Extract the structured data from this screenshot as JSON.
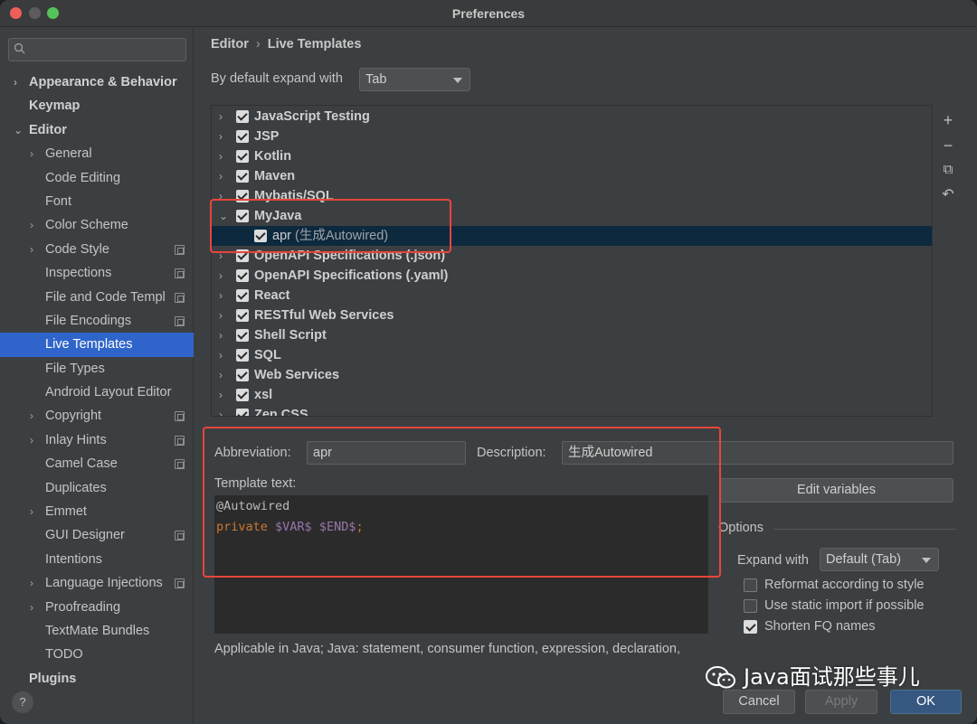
{
  "window": {
    "title": "Preferences"
  },
  "sidebar": {
    "search_placeholder": "",
    "items": [
      {
        "label": "Appearance & Behavior",
        "chev": "›",
        "bold": true,
        "indent": 0,
        "cfg": false,
        "selected": false
      },
      {
        "label": "Keymap",
        "chev": "",
        "bold": true,
        "indent": 0,
        "cfg": false,
        "selected": false
      },
      {
        "label": "Editor",
        "chev": "⌄",
        "bold": true,
        "indent": 0,
        "cfg": false,
        "selected": false
      },
      {
        "label": "General",
        "chev": "›",
        "bold": false,
        "indent": 1,
        "cfg": false,
        "selected": false
      },
      {
        "label": "Code Editing",
        "chev": "",
        "bold": false,
        "indent": 1,
        "cfg": false,
        "selected": false
      },
      {
        "label": "Font",
        "chev": "",
        "bold": false,
        "indent": 1,
        "cfg": false,
        "selected": false
      },
      {
        "label": "Color Scheme",
        "chev": "›",
        "bold": false,
        "indent": 1,
        "cfg": false,
        "selected": false
      },
      {
        "label": "Code Style",
        "chev": "›",
        "bold": false,
        "indent": 1,
        "cfg": true,
        "selected": false
      },
      {
        "label": "Inspections",
        "chev": "",
        "bold": false,
        "indent": 1,
        "cfg": true,
        "selected": false
      },
      {
        "label": "File and Code Templ",
        "chev": "",
        "bold": false,
        "indent": 1,
        "cfg": true,
        "selected": false
      },
      {
        "label": "File Encodings",
        "chev": "",
        "bold": false,
        "indent": 1,
        "cfg": true,
        "selected": false
      },
      {
        "label": "Live Templates",
        "chev": "",
        "bold": false,
        "indent": 1,
        "cfg": false,
        "selected": true
      },
      {
        "label": "File Types",
        "chev": "",
        "bold": false,
        "indent": 1,
        "cfg": false,
        "selected": false
      },
      {
        "label": "Android Layout Editor",
        "chev": "",
        "bold": false,
        "indent": 1,
        "cfg": false,
        "selected": false
      },
      {
        "label": "Copyright",
        "chev": "›",
        "bold": false,
        "indent": 1,
        "cfg": true,
        "selected": false
      },
      {
        "label": "Inlay Hints",
        "chev": "›",
        "bold": false,
        "indent": 1,
        "cfg": true,
        "selected": false
      },
      {
        "label": "Camel Case",
        "chev": "",
        "bold": false,
        "indent": 1,
        "cfg": true,
        "selected": false
      },
      {
        "label": "Duplicates",
        "chev": "",
        "bold": false,
        "indent": 1,
        "cfg": false,
        "selected": false
      },
      {
        "label": "Emmet",
        "chev": "›",
        "bold": false,
        "indent": 1,
        "cfg": false,
        "selected": false
      },
      {
        "label": "GUI Designer",
        "chev": "",
        "bold": false,
        "indent": 1,
        "cfg": true,
        "selected": false
      },
      {
        "label": "Intentions",
        "chev": "",
        "bold": false,
        "indent": 1,
        "cfg": false,
        "selected": false
      },
      {
        "label": "Language Injections",
        "chev": "›",
        "bold": false,
        "indent": 1,
        "cfg": true,
        "selected": false
      },
      {
        "label": "Proofreading",
        "chev": "›",
        "bold": false,
        "indent": 1,
        "cfg": false,
        "selected": false
      },
      {
        "label": "TextMate Bundles",
        "chev": "",
        "bold": false,
        "indent": 1,
        "cfg": false,
        "selected": false
      },
      {
        "label": "TODO",
        "chev": "",
        "bold": false,
        "indent": 1,
        "cfg": false,
        "selected": false
      },
      {
        "label": "Plugins",
        "chev": "",
        "bold": true,
        "indent": 0,
        "cfg": false,
        "selected": false
      }
    ],
    "help_label": "?"
  },
  "breadcrumb": {
    "parent": "Editor",
    "separator": "›",
    "current": "Live Templates"
  },
  "expand_default": {
    "label": "By default expand with",
    "value": "Tab"
  },
  "template_tree": [
    {
      "label": "JavaScript Testing",
      "desc": "",
      "chev": "›",
      "level": 0,
      "selected": false
    },
    {
      "label": "JSP",
      "desc": "",
      "chev": "›",
      "level": 0,
      "selected": false
    },
    {
      "label": "Kotlin",
      "desc": "",
      "chev": "›",
      "level": 0,
      "selected": false
    },
    {
      "label": "Maven",
      "desc": "",
      "chev": "›",
      "level": 0,
      "selected": false
    },
    {
      "label": "Mybatis/SQL",
      "desc": "",
      "chev": "›",
      "level": 0,
      "selected": false
    },
    {
      "label": "MyJava",
      "desc": "",
      "chev": "⌄",
      "level": 0,
      "selected": false
    },
    {
      "label": "apr",
      "desc": " (生成Autowired)",
      "chev": "",
      "level": 1,
      "selected": true
    },
    {
      "label": "OpenAPI Specifications (.json)",
      "desc": "",
      "chev": "›",
      "level": 0,
      "selected": false
    },
    {
      "label": "OpenAPI Specifications (.yaml)",
      "desc": "",
      "chev": "›",
      "level": 0,
      "selected": false
    },
    {
      "label": "React",
      "desc": "",
      "chev": "›",
      "level": 0,
      "selected": false
    },
    {
      "label": "RESTful Web Services",
      "desc": "",
      "chev": "›",
      "level": 0,
      "selected": false
    },
    {
      "label": "Shell Script",
      "desc": "",
      "chev": "›",
      "level": 0,
      "selected": false
    },
    {
      "label": "SQL",
      "desc": "",
      "chev": "›",
      "level": 0,
      "selected": false
    },
    {
      "label": "Web Services",
      "desc": "",
      "chev": "›",
      "level": 0,
      "selected": false
    },
    {
      "label": "xsl",
      "desc": "",
      "chev": "›",
      "level": 0,
      "selected": false
    },
    {
      "label": "Zen CSS",
      "desc": "",
      "chev": "›",
      "level": 0,
      "selected": false
    }
  ],
  "tree_tools": {
    "add": "+",
    "remove": "−",
    "copy": "⧉",
    "restore": "↶"
  },
  "editor_panel": {
    "abbreviation_label": "Abbreviation:",
    "abbreviation_value": "apr",
    "description_label": "Description:",
    "description_value": "生成Autowired",
    "template_text_label": "Template text:",
    "code_line1": "@Autowired",
    "code_kw": "private",
    "code_var1": "$VAR$",
    "code_var2": "$END$",
    "code_semicolon": ";",
    "edit_variables_label": "Edit variables",
    "options_title": "Options",
    "expand_with_label": "Expand with",
    "expand_with_value": "Default (Tab)",
    "options": [
      {
        "label": "Reformat according to style",
        "checked": false
      },
      {
        "label": "Use static import if possible",
        "checked": false
      },
      {
        "label": "Shorten FQ names",
        "checked": true
      }
    ],
    "applicable_text": "Applicable in Java; Java: statement, consumer function, expression, declaration,"
  },
  "dialog_buttons": {
    "cancel": "Cancel",
    "apply": "Apply",
    "ok": "OK"
  },
  "watermark": {
    "text": "Java面试那些事儿"
  },
  "colors": {
    "accent_selection": "#2f65ca",
    "highlight_box": "#e8453c",
    "keyword": "#cc7832",
    "variable": "#9876aa"
  }
}
